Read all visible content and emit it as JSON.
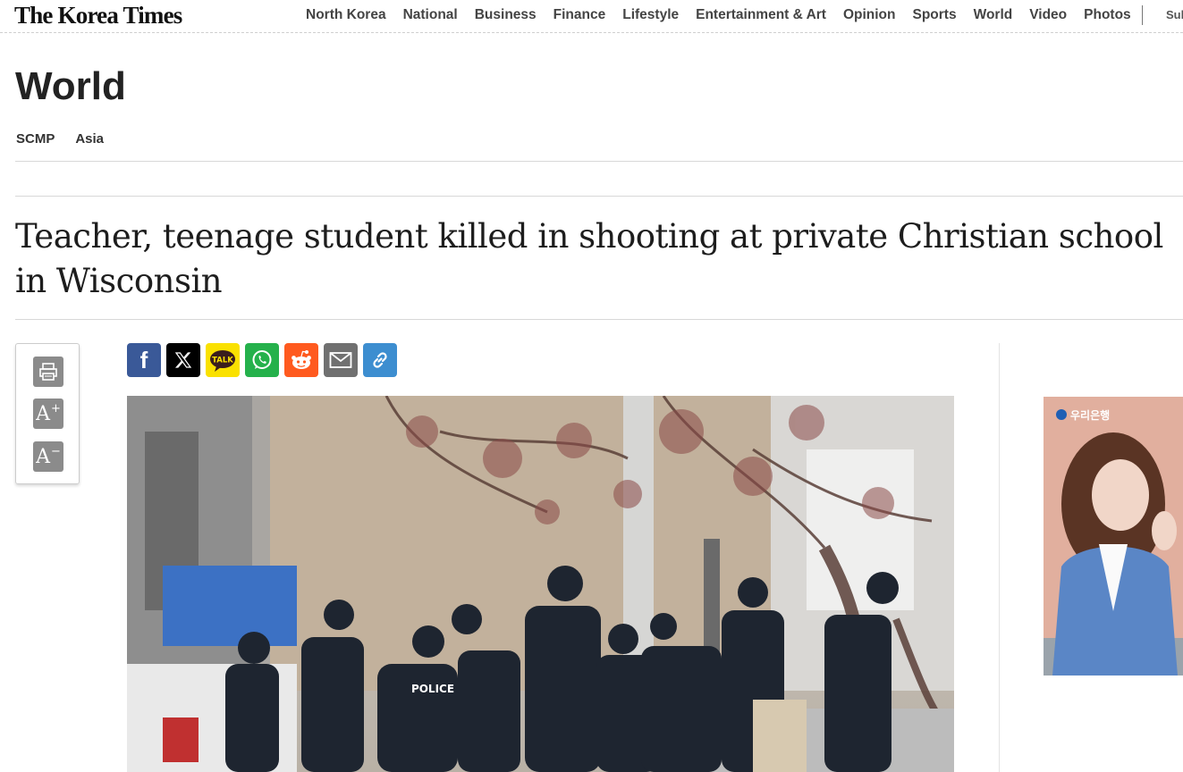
{
  "site": {
    "logo_text": "The Korea Times"
  },
  "nav": {
    "items": [
      "North Korea",
      "National",
      "Business",
      "Finance",
      "Lifestyle",
      "Entertainment & Art",
      "Opinion",
      "Sports",
      "World",
      "Video",
      "Photos"
    ],
    "subscribe_partial": "Sul"
  },
  "section": {
    "title": "World",
    "subnav": [
      "SCMP",
      "Asia"
    ]
  },
  "article": {
    "headline": "Teacher, teenage student killed in shooting at private Christian school in Wisconsin"
  },
  "tools": {
    "print_icon": "printer-icon",
    "increase_font_icon": "font-increase-icon",
    "decrease_font_icon": "font-decrease-icon"
  },
  "share": {
    "buttons": [
      {
        "icon": "facebook-icon",
        "color": "#3a5998"
      },
      {
        "icon": "x-twitter-icon",
        "color": "#000000"
      },
      {
        "icon": "kakaotalk-icon",
        "color": "#fae100",
        "label": "TALK"
      },
      {
        "icon": "whatsapp-icon",
        "color": "#25b14b"
      },
      {
        "icon": "reddit-icon",
        "color": "#ff5a1f"
      },
      {
        "icon": "email-icon",
        "color": "#707070"
      },
      {
        "icon": "link-icon",
        "color": "#3d8ed0"
      }
    ]
  },
  "ad": {
    "brand_text": "우리은행"
  }
}
